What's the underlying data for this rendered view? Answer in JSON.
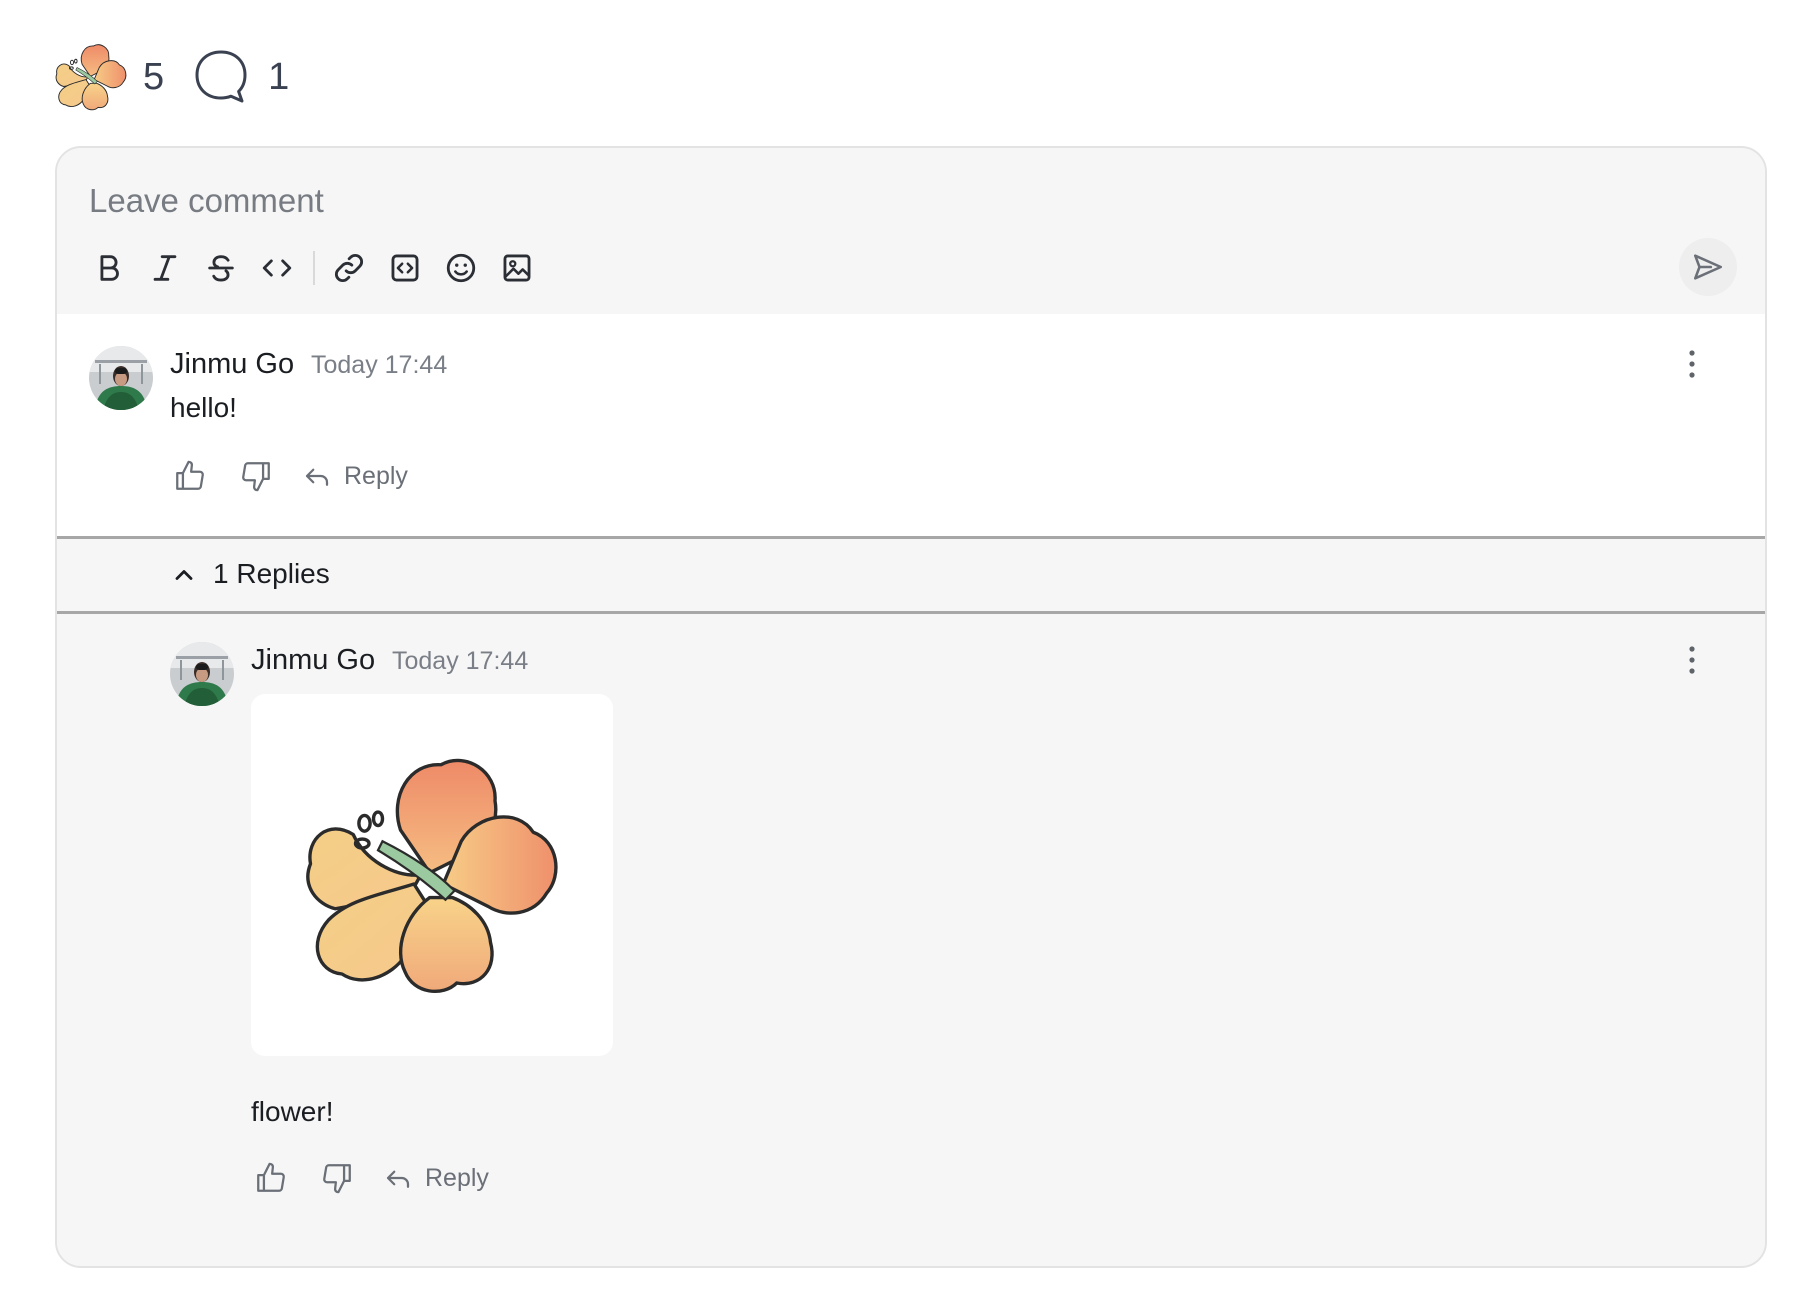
{
  "stats": {
    "reaction_icon": "hibiscus-flower-emoji",
    "reaction_count": "5",
    "comment_icon": "speech-bubble-icon",
    "comment_count": "1"
  },
  "editor": {
    "placeholder": "Leave comment",
    "toolbar": [
      "bold",
      "italic",
      "strikethrough",
      "code",
      "link",
      "code-block",
      "emoji",
      "image"
    ],
    "send_icon": "send-icon"
  },
  "comment": {
    "author": "Jinmu Go",
    "time": "Today 17:44",
    "text": "hello!",
    "reply_label": "Reply"
  },
  "replies_toggle": {
    "label": "1 Replies"
  },
  "reply": {
    "author": "Jinmu Go",
    "time": "Today 17:44",
    "image": "hibiscus-flower-sticker",
    "text": "flower!",
    "reply_label": "Reply"
  },
  "colors": {
    "card_background": "#f6f6f6",
    "flower_orange": "#f0906a",
    "flower_yellow": "#f6cf8a",
    "stem_green": "#9ccaa0"
  }
}
